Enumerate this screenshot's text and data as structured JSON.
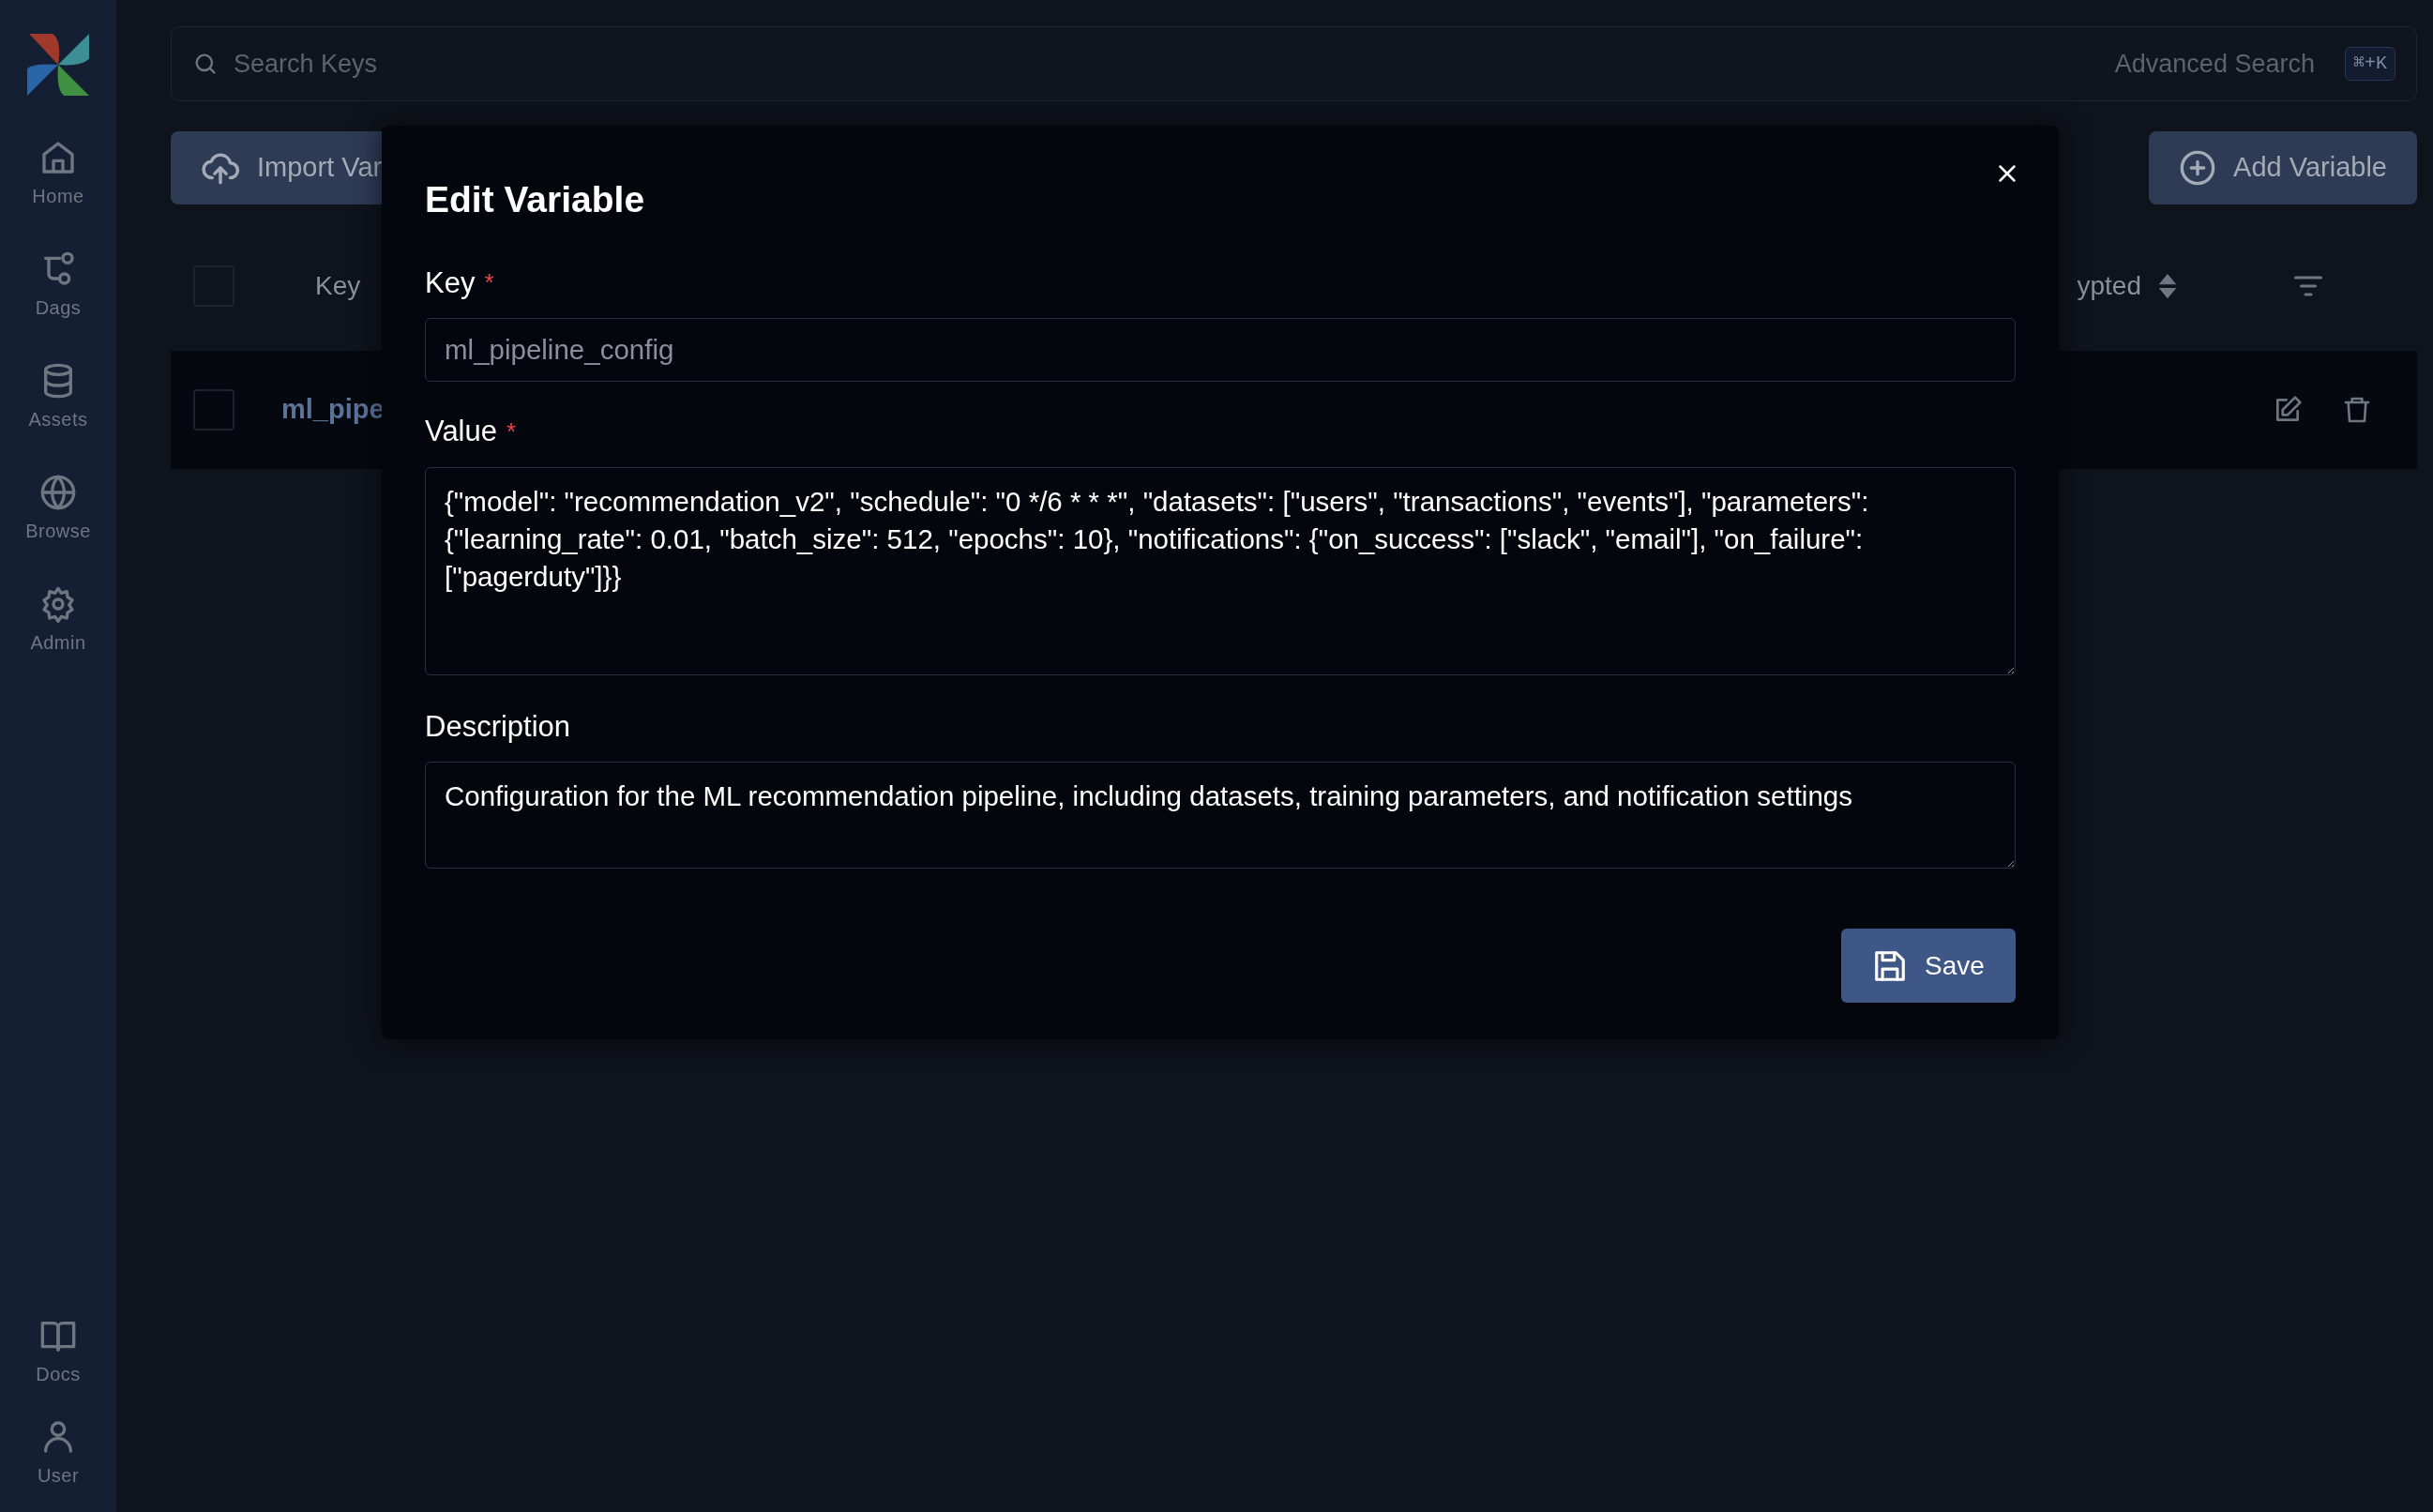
{
  "sidebar": {
    "items": [
      {
        "label": "Home"
      },
      {
        "label": "Dags"
      },
      {
        "label": "Assets"
      },
      {
        "label": "Browse"
      },
      {
        "label": "Admin"
      }
    ],
    "bottom_items": [
      {
        "label": "Docs"
      },
      {
        "label": "User"
      }
    ]
  },
  "search": {
    "placeholder": "Search Keys",
    "advanced": "Advanced Search",
    "shortcut": "⌘+K"
  },
  "toolbar": {
    "import_button": "Import Var",
    "add_button": "Add Variable"
  },
  "table": {
    "columns": [
      {
        "label": "Key"
      },
      {
        "label": "ypted"
      }
    ],
    "rows": [
      {
        "key": "ml_pipe",
        "selected": false
      }
    ],
    "header_selected": false
  },
  "dialog": {
    "title": "Edit Variable",
    "fields": [
      {
        "label": "Key",
        "required_mark": "*",
        "kind": "input",
        "value": "ml_pipeline_config",
        "disabled": true
      },
      {
        "label": "Value",
        "required_mark": "*",
        "kind": "textarea",
        "value": "{\"model\": \"recommendation_v2\", \"schedule\": \"0 */6 * * *\", \"datasets\": [\"users\", \"transactions\", \"events\"], \"parameters\": {\"learning_rate\": 0.01, \"batch_size\": 512, \"epochs\": 10}, \"notifications\": {\"on_success\": [\"slack\", \"email\"], \"on_failure\": [\"pagerduty\"]}}",
        "disabled": false
      },
      {
        "label": "Description",
        "kind": "textarea",
        "value": "Configuration for the ML recommendation pipeline, including datasets, training parameters, and notification settings",
        "disabled": false
      }
    ],
    "save_button": "Save"
  }
}
